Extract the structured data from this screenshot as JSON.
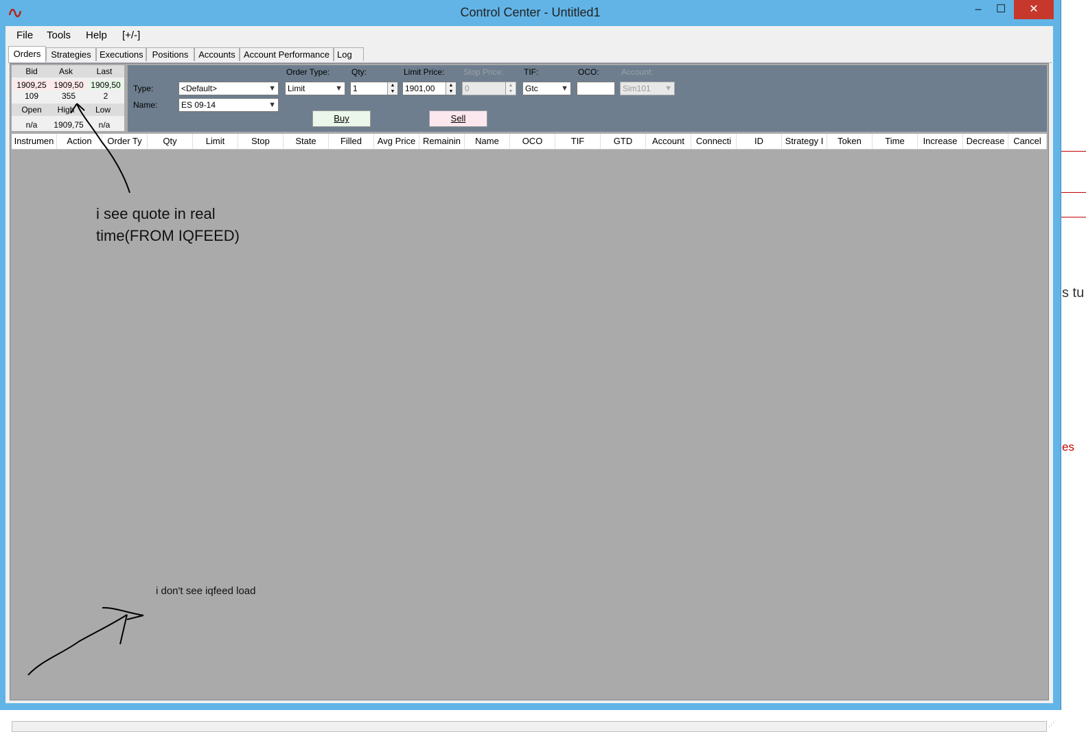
{
  "window": {
    "title": "Control Center - Untitled1",
    "minimize_glyph": "–",
    "maximize_glyph": "☐",
    "close_glyph": "✕",
    "logo_icon": "ninja-logo-icon"
  },
  "menu": [
    {
      "label": "File"
    },
    {
      "label": "Tools"
    },
    {
      "label": "Help"
    },
    {
      "label": "[+/-]"
    }
  ],
  "tabs": [
    {
      "label": "Orders",
      "active": true
    },
    {
      "label": "Strategies"
    },
    {
      "label": "Executions"
    },
    {
      "label": "Positions"
    },
    {
      "label": "Accounts"
    },
    {
      "label": "Account Performance"
    },
    {
      "label": "Log"
    }
  ],
  "quote": {
    "headers1": [
      "Bid",
      "Ask",
      "Last"
    ],
    "prices": [
      "1909,25",
      "1909,50",
      "1909,50"
    ],
    "sizes": [
      "109",
      "355",
      "2"
    ],
    "headers2": [
      "Open",
      "High",
      "Low"
    ],
    "values2": [
      "n/a",
      "1909,75",
      "n/a"
    ]
  },
  "order_form": {
    "type_label": "Type:",
    "type_value": "<Default>",
    "name_label": "Name:",
    "name_value": "ES 09-14",
    "order_type_label": "Order Type:",
    "order_type_value": "Limit",
    "qty_label": "Qty:",
    "qty_value": "1",
    "limit_price_label": "Limit Price:",
    "limit_price_value": "1901,00",
    "stop_price_label": "Stop Price:",
    "stop_price_value": "0",
    "tif_label": "TIF:",
    "tif_value": "Gtc",
    "oco_label": "OCO:",
    "oco_value": "",
    "account_label": "Account:",
    "account_value": "Sim101",
    "buy_label": "Buy",
    "sell_label": "Sell"
  },
  "grid_columns": [
    "Instrumen",
    "Action",
    "Order Ty",
    "Qty",
    "Limit",
    "Stop",
    "State",
    "Filled",
    "Avg Price",
    "Remainin",
    "Name",
    "OCO",
    "TIF",
    "GTD",
    "Account",
    "Connecti",
    "ID",
    "Strategy I",
    "Token",
    "Time",
    "Increase",
    "Decrease",
    "Cancel"
  ],
  "annotations": {
    "quote_note_line1": "i see quote in real",
    "quote_note_line2": "time(FROM IQFEED)",
    "load_note": "i don't see iqfeed load"
  },
  "background": {
    "text1": "s tu",
    "text2": "es"
  },
  "colors": {
    "titlebar": "#62b4e6",
    "close": "#c7382c",
    "order_panel": "#6e7e8e",
    "grid_bg": "#aaaaaa",
    "buy_bg": "#eaf7ea",
    "sell_bg": "#fbe8ee"
  }
}
